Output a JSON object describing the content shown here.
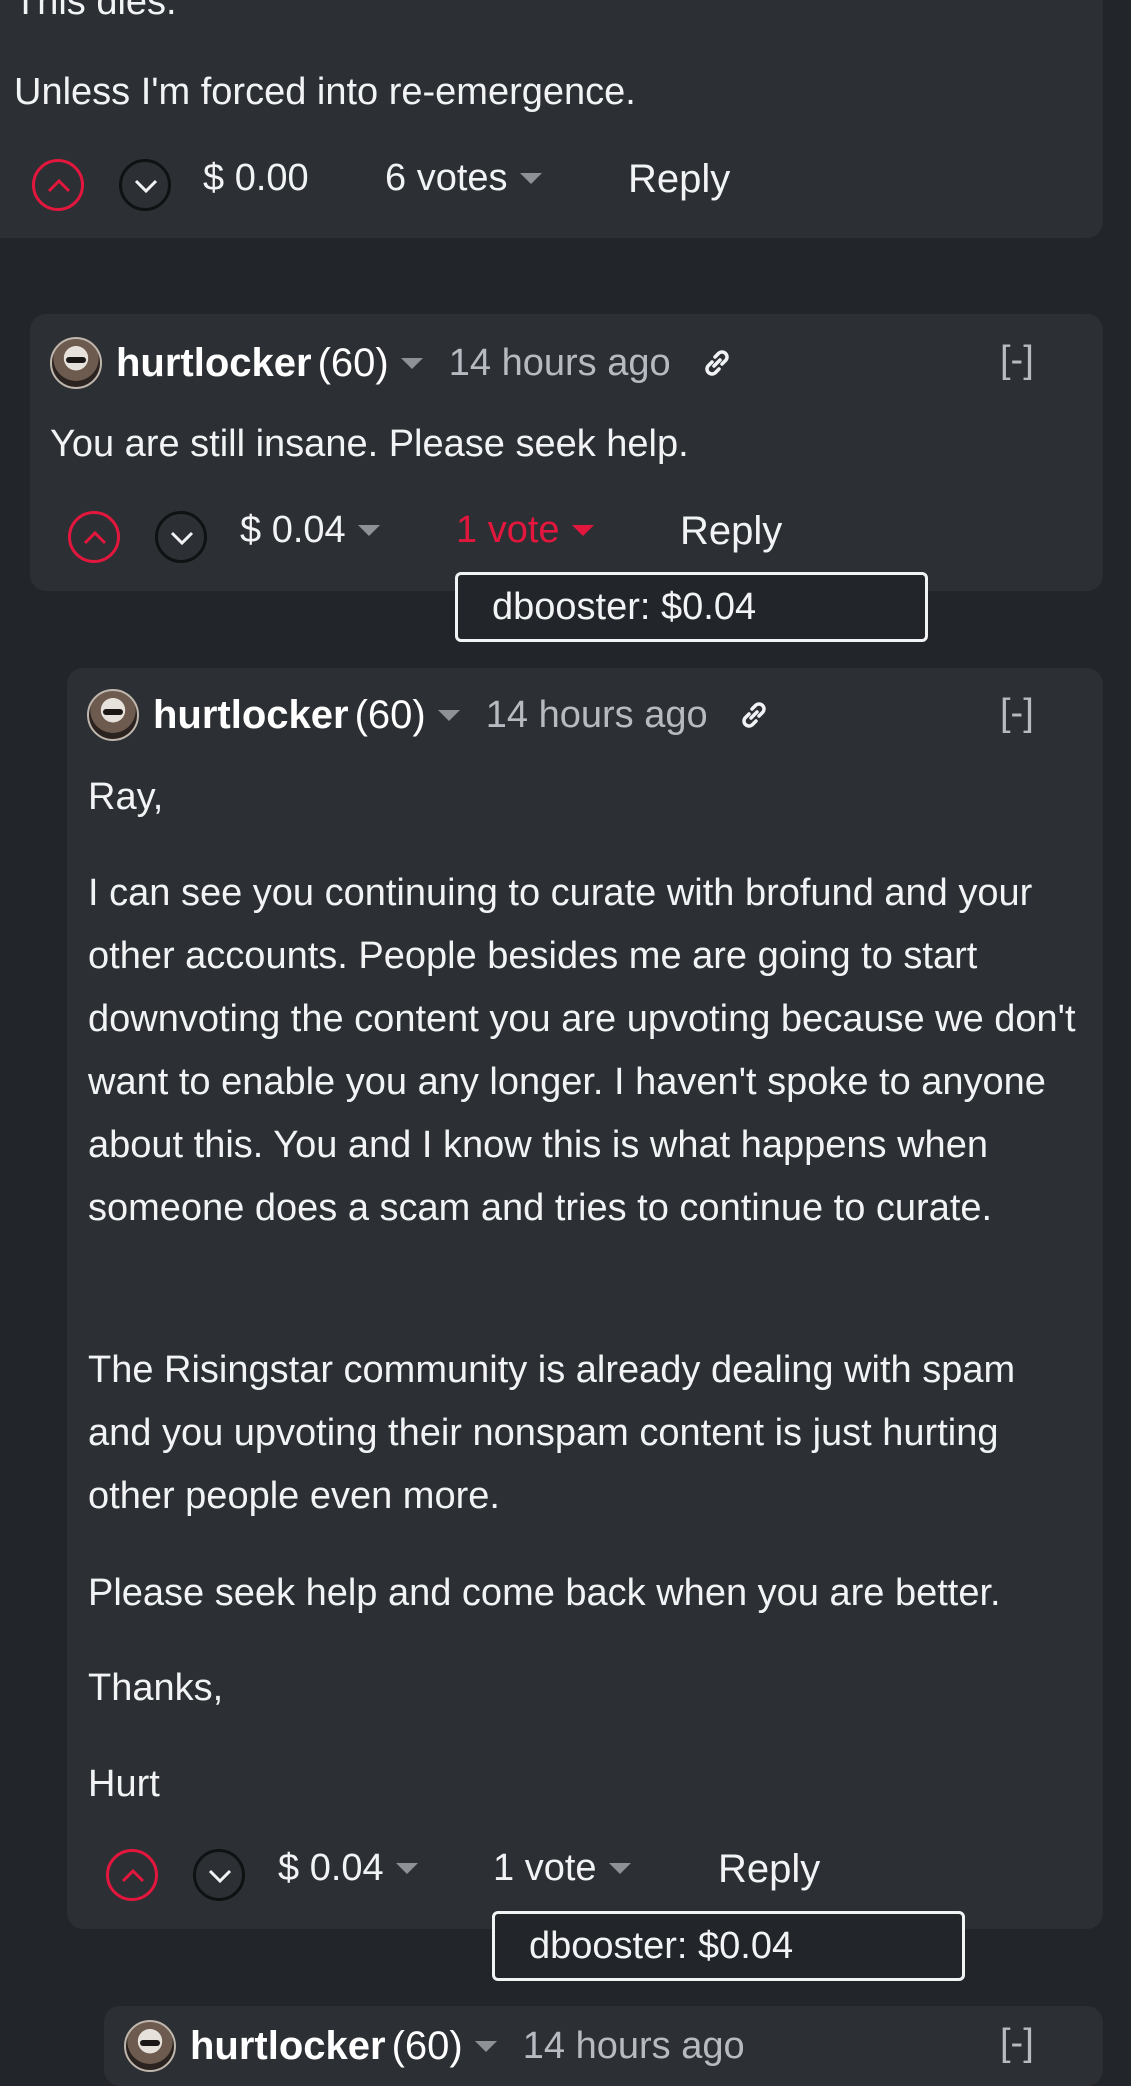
{
  "top_comment": {
    "partial_line": "This dies.",
    "body": "Unless I'm forced into re-emergence.",
    "payout": "$ 0.00",
    "votes": "6 votes",
    "reply_label": "Reply"
  },
  "comment_1": {
    "author": "hurtlocker",
    "reputation": "(60)",
    "time": "14 hours ago",
    "collapse": "[-]",
    "body": "You are still insane. Please seek help.",
    "payout": "$ 0.04",
    "votes": "1 vote",
    "reply_label": "Reply",
    "tooltip": "dbooster: $0.04"
  },
  "comment_2": {
    "author": "hurtlocker",
    "reputation": "(60)",
    "time": "14 hours ago",
    "collapse": "[-]",
    "paragraphs": [
      "Ray,",
      "I can see you continuing to curate with brofund and your other accounts. People besides me are going to start downvoting the content you are upvoting because we don't want to enable you any longer. I haven't spoke to anyone about this. You and I know this is what happens when someone does a scam and tries to continue to curate.",
      "The Risingstar community is already dealing with spam and you upvoting their nonspam content is just hurting other people even more.",
      "Please seek help and come back when you are better.",
      "Thanks,",
      "Hurt"
    ],
    "payout": "$ 0.04",
    "votes": "1 vote",
    "reply_label": "Reply",
    "tooltip": "dbooster: $0.04"
  },
  "comment_3": {
    "author": "hurtlocker",
    "reputation": "(60)",
    "time": "14 hours ago",
    "collapse": "[-]"
  },
  "colors": {
    "background": "#222529",
    "card": "#2c2f33",
    "accent_red": "#e3173d",
    "muted_text": "#b7bbc1"
  },
  "icons": [
    "upvote-icon",
    "downvote-icon",
    "caret-down-icon",
    "link-icon"
  ]
}
